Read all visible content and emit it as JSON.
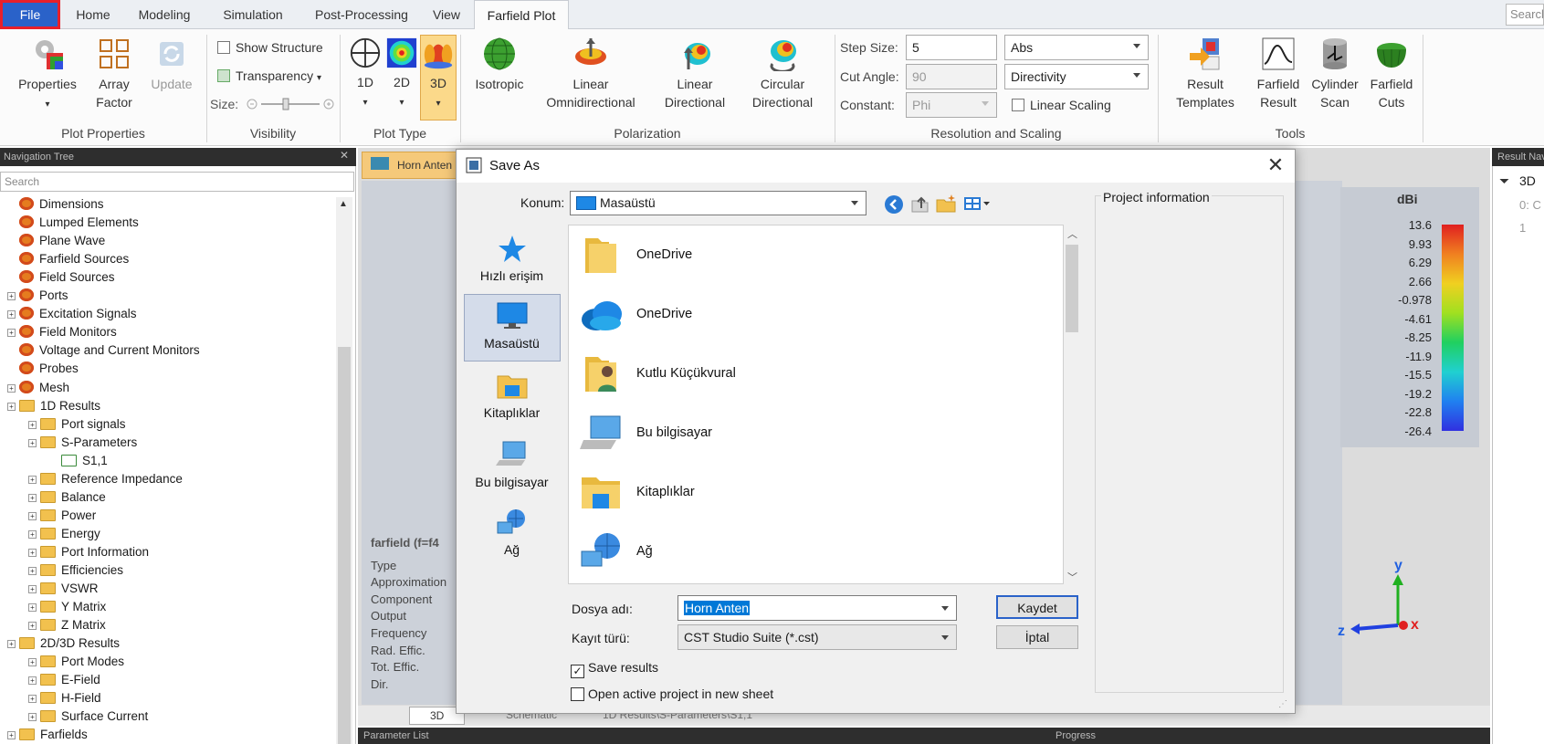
{
  "menubar": {
    "file": "File",
    "tabs": [
      "Home",
      "Modeling",
      "Simulation",
      "Post-Processing",
      "View",
      "Farfield Plot"
    ],
    "search_placeholder": "Search"
  },
  "ribbon": {
    "plot_properties": {
      "properties": "Properties",
      "array_factor": "Array\nFactor",
      "update": "Update",
      "label": "Plot Properties"
    },
    "visibility": {
      "show_structure": "Show Structure",
      "transparency": "Transparency",
      "size": "Size:",
      "label": "Visibility"
    },
    "plot_type": {
      "d1": "1D",
      "d2": "2D",
      "d3": "3D",
      "label": "Plot Type"
    },
    "polarization": {
      "isotropic": "Isotropic",
      "linear_omni": "Linear\nOmnidirectional",
      "linear_dir": "Linear\nDirectional",
      "circular_dir": "Circular\nDirectional",
      "label": "Polarization"
    },
    "resolution": {
      "step_size_label": "Step Size:",
      "step_size": "5",
      "cut_angle_label": "Cut Angle:",
      "cut_angle": "90",
      "constant_label": "Constant:",
      "constant": "Phi",
      "abs": "Abs",
      "directivity": "Directivity",
      "linear_scaling": "Linear Scaling",
      "label": "Resolution and Scaling"
    },
    "tools": {
      "result_templates": "Result\nTemplates",
      "farfield_result": "Farfield\nResult",
      "cylinder_scan": "Cylinder\nScan",
      "farfield_cuts": "Farfield\nCuts",
      "label": "Tools"
    }
  },
  "nav": {
    "title": "Navigation Tree",
    "search": "Search",
    "items": [
      "Dimensions",
      "Lumped Elements",
      "Plane Wave",
      "Farfield Sources",
      "Field Sources",
      "Ports",
      "Excitation Signals",
      "Field Monitors",
      "Voltage and Current Monitors",
      "Probes",
      "Mesh",
      "1D Results",
      "Port signals",
      "S-Parameters",
      "S1,1",
      "Reference Impedance",
      "Balance",
      "Power",
      "Energy",
      "Port Information",
      "Efficiencies",
      "VSWR",
      "Y Matrix",
      "Z Matrix",
      "2D/3D Results",
      "Port Modes",
      "E-Field",
      "H-Field",
      "Surface Current",
      "Farfields"
    ]
  },
  "view": {
    "tab": "Horn Anten",
    "info_title": "farfield (f=f4",
    "info_rows": [
      "Type",
      "Approximation",
      "Component",
      "Output",
      "Frequency",
      "Rad. Effic.",
      "Tot. Effic.",
      "Dir."
    ],
    "bottom_tabs": [
      "3D",
      "Schematic",
      "1D Results\\S-Parameters\\S1,1"
    ],
    "param_list": "Parameter List",
    "progress": "Progress"
  },
  "legend": {
    "unit": "dBi",
    "values": [
      "13.6",
      "9.93",
      "6.29",
      "2.66",
      "-0.978",
      "-4.61",
      "-8.25",
      "-11.9",
      "-15.5",
      "-19.2",
      "-22.8",
      "-26.4"
    ],
    "axes": [
      "y",
      "z",
      "x"
    ]
  },
  "right_panel": {
    "title": "Result Navigator",
    "rows": [
      "3D",
      "0: C",
      "1"
    ]
  },
  "dialog": {
    "title": "Save As",
    "konum_label": "Konum:",
    "konum_value": "Masaüstü",
    "places": [
      "Hızlı erişim",
      "Masaüstü",
      "Kitaplıklar",
      "Bu bilgisayar",
      "Ağ"
    ],
    "files": [
      "OneDrive",
      "OneDrive",
      "Kutlu Küçükvural",
      "Bu bilgisayar",
      "Kitaplıklar",
      "Ağ"
    ],
    "project_info": "Project information",
    "filename_label": "Dosya adı:",
    "filename": "Horn Anten",
    "type_label": "Kayıt türü:",
    "type_value": "CST Studio Suite (*.cst)",
    "save": "Kaydet",
    "cancel": "İptal",
    "save_results": "Save results",
    "open_new_sheet": "Open active project in new sheet"
  }
}
